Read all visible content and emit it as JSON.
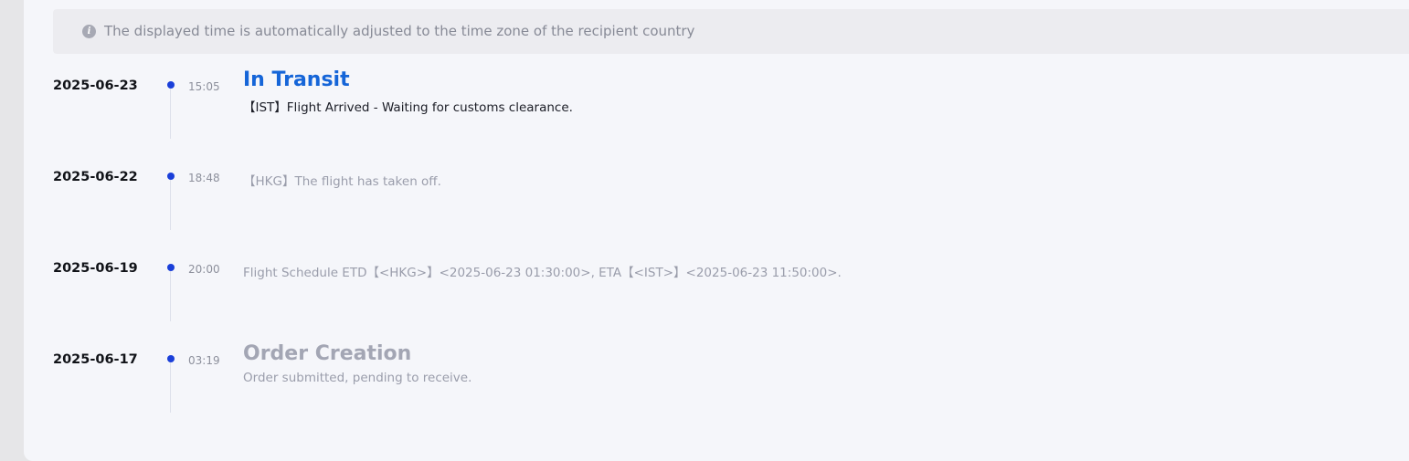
{
  "notice": {
    "icon": "info-icon",
    "text": "The displayed time is automatically adjusted to the time zone of the recipient country"
  },
  "timeline": [
    {
      "date": "2025-06-23",
      "time": "15:05",
      "status": "In Transit",
      "detail": "【IST】Flight Arrived - Waiting for customs clearance."
    },
    {
      "date": "2025-06-22",
      "time": "18:48",
      "detail": "【HKG】The flight has taken off."
    },
    {
      "date": "2025-06-19",
      "time": "20:00",
      "detail": "Flight Schedule ETD【<HKG>】<2025-06-23 01:30:00>, ETA【<IST>】<2025-06-23 11:50:00>."
    },
    {
      "date": "2025-06-17",
      "time": "03:19",
      "status": "Order Creation",
      "detail": "Order submitted, pending to receive."
    }
  ],
  "colors": {
    "accent": "#1565d8",
    "dot": "#1a3fd9",
    "muted": "#a3a6b4",
    "panel": "#f5f6fa",
    "notice_bg": "#ececf0"
  }
}
